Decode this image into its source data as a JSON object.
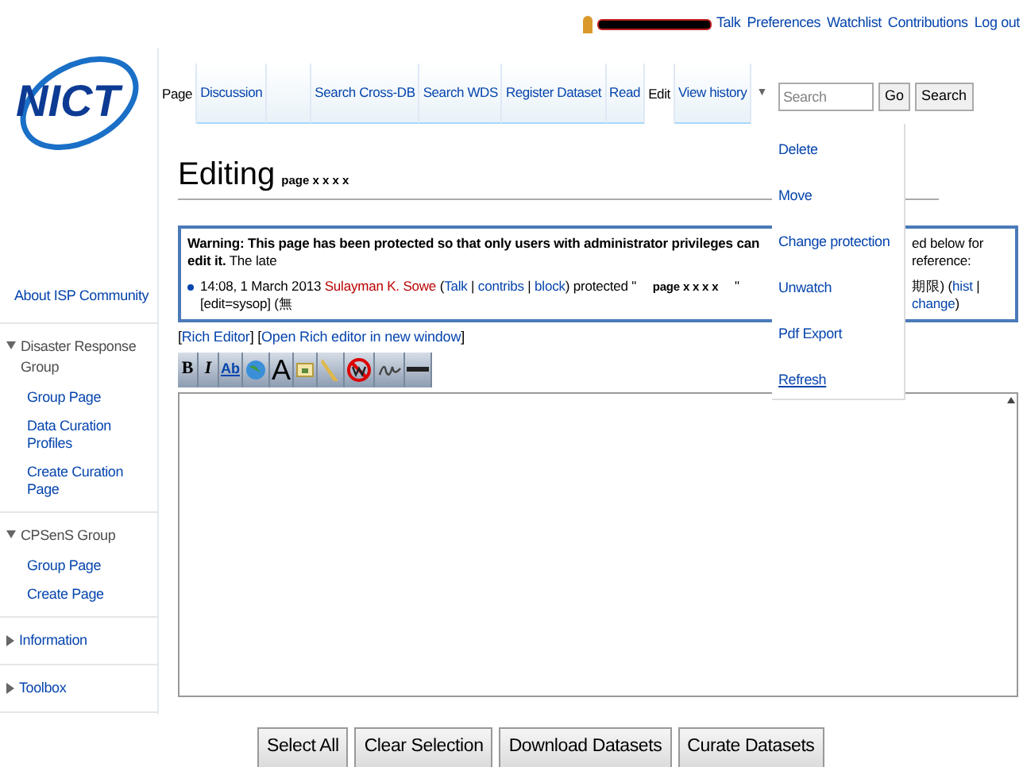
{
  "user_bar": {
    "links": [
      "Talk",
      "Preferences",
      "Watchlist",
      "Contributions",
      "Log out"
    ]
  },
  "logo": {
    "text": "NICT"
  },
  "sidebar": {
    "top_link": "About ISP Community",
    "portlets": [
      {
        "title": "Disaster Response Group",
        "expanded": true,
        "items": [
          "Group Page",
          "Data Curation Profiles",
          "Create Curation Page"
        ]
      },
      {
        "title": "CPSenS Group",
        "expanded": true,
        "items": [
          "Group Page",
          "Create Page"
        ]
      },
      {
        "title": "Information",
        "expanded": false
      },
      {
        "title": "Toolbox",
        "expanded": false
      }
    ]
  },
  "tabs_left": [
    {
      "label": "Page",
      "selected": true
    },
    {
      "label": "Discussion",
      "selected": false
    }
  ],
  "tabs_right": [
    {
      "label": "Search Cross-DB",
      "selected": false
    },
    {
      "label": "Search WDS",
      "selected": false
    },
    {
      "label": "Register Dataset",
      "selected": false
    },
    {
      "label": "Read",
      "selected": false
    },
    {
      "label": "Edit",
      "selected": true
    },
    {
      "label": "View history",
      "selected": false
    }
  ],
  "more_menu": {
    "arrow": "▼",
    "expanded": true,
    "items": [
      "Delete",
      "Move",
      "Change protection",
      "Unwatch",
      "Pdf Export",
      "Refresh"
    ]
  },
  "search": {
    "placeholder": "Search",
    "buttons": [
      "Go",
      "Search"
    ]
  },
  "heading": {
    "title": "Editing",
    "page": "page x x x x"
  },
  "warning": {
    "bold": "Warning: This page has been protected so that only users with administrator privileges can edit it.",
    "text_left": "The late",
    "text_right": "ed below for reference:",
    "log_left": [
      {
        "kind": "text",
        "text": "14:08, 1 March 2013 "
      },
      {
        "kind": "user",
        "text": "Sulayman K. Sowe"
      },
      {
        "kind": "text",
        "text": " ("
      },
      {
        "kind": "link",
        "text": "Talk"
      },
      {
        "kind": "text",
        "text": " | "
      },
      {
        "kind": "link",
        "text": "contribs"
      },
      {
        "kind": "text",
        "text": " | "
      },
      {
        "kind": "link",
        "text": "block"
      },
      {
        "kind": "text",
        "text": ") protected \" "
      },
      {
        "kind": "page",
        "text": "page x x x x"
      },
      {
        "kind": "text",
        "text": " \" [edit=sysop] (無"
      }
    ],
    "log_right": [
      {
        "kind": "text",
        "text": "期限) ("
      },
      {
        "kind": "link",
        "text": "hist"
      },
      {
        "kind": "text",
        "text": " | "
      },
      {
        "kind": "link",
        "text": "change"
      },
      {
        "kind": "text",
        "text": ")"
      }
    ]
  },
  "editor_links": [
    {
      "kind": "text",
      "text": "["
    },
    {
      "kind": "link",
      "text": "Rich Editor"
    },
    {
      "kind": "text",
      "text": "] ["
    },
    {
      "kind": "link",
      "text": "Open Rich editor in new window"
    },
    {
      "kind": "text",
      "text": "]"
    }
  ],
  "toolbar": [
    {
      "kind": "bold",
      "label": "B"
    },
    {
      "kind": "italic",
      "label": "I"
    },
    {
      "kind": "link",
      "label": "Ab"
    },
    {
      "kind": "globe"
    },
    {
      "kind": "big",
      "label": "A"
    },
    {
      "kind": "image"
    },
    {
      "kind": "media"
    },
    {
      "kind": "nowiki"
    },
    {
      "kind": "signature"
    },
    {
      "kind": "rule"
    }
  ],
  "buttons": [
    "Select All",
    "Clear Selection",
    "Download Datasets",
    "Curate Datasets"
  ]
}
